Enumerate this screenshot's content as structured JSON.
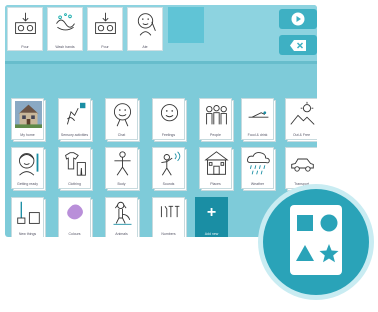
{
  "sentence": {
    "tiles": [
      {
        "label": "Pour",
        "icon": "pour-icon"
      },
      {
        "label": "Wash hands",
        "icon": "wash-hands-icon"
      },
      {
        "label": "Pour",
        "icon": "pour-icon"
      },
      {
        "label": "Ate",
        "icon": "ate-icon"
      }
    ],
    "play_icon": "play-icon",
    "clear_icon": "backspace-icon"
  },
  "folders": [
    {
      "label": "My home",
      "icon": "house-photo"
    },
    {
      "label": "Sensory activities",
      "icon": "sensory-icon"
    },
    {
      "label": "Chat",
      "icon": "chat-face-icon"
    },
    {
      "label": "Feelings",
      "icon": "feelings-icon"
    },
    {
      "label": "People",
      "icon": "people-icon"
    },
    {
      "label": "Food & drink",
      "icon": "food-icon"
    },
    {
      "label": "Out & Free",
      "icon": "out-icon"
    },
    {
      "label": "Getting ready",
      "icon": "getting-ready-icon"
    },
    {
      "label": "Clothing",
      "icon": "clothing-icon"
    },
    {
      "label": "Body",
      "icon": "body-icon"
    },
    {
      "label": "Sounds",
      "icon": "sounds-icon"
    },
    {
      "label": "Places",
      "icon": "school-icon"
    },
    {
      "label": "Weather",
      "icon": "weather-icon"
    },
    {
      "label": "Transport",
      "icon": "car-icon"
    },
    {
      "label": "New things",
      "icon": "new-things-icon"
    },
    {
      "label": "Colours",
      "icon": "colours-icon"
    },
    {
      "label": "Animals",
      "icon": "dog-icon"
    },
    {
      "label": "Numbers",
      "icon": "numbers-icon"
    },
    {
      "label": "Add new",
      "icon": "plus-icon"
    }
  ],
  "colors": {
    "panel": "#7ecbd9",
    "sentence_bar": "#8dd3e0",
    "button": "#3eb0c3",
    "add_tile": "#1a8ea4",
    "badge": "#2aa3b8"
  },
  "badge_icon": "shapes-board-icon"
}
